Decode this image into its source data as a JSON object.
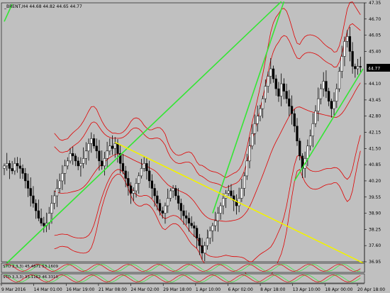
{
  "window": {
    "symbol_header": "_BRENT,H4 44.68 44.82 44.65 44.77"
  },
  "indicators": {
    "first": "STO 3,3,3) 45.4871 53.1609",
    "second": "STO 3,3,3) 33.1162 46.3310"
  },
  "chart_data": {
    "type": "candlestick",
    "symbol": "_BRENT",
    "timeframe": "H4",
    "last": {
      "open": 44.68,
      "high": 44.82,
      "low": 44.65,
      "close": 44.77
    },
    "current_price_label": "44.77",
    "ylim": [
      36.95,
      47.35
    ],
    "y_ticks": [
      "47.35",
      "46.70",
      "46.05",
      "45.40",
      "44.77",
      "44.10",
      "43.45",
      "42.80",
      "42.15",
      "41.50",
      "40.85",
      "40.20",
      "39.55",
      "38.90",
      "38.25",
      "37.60",
      "36.95"
    ],
    "x_ticks": [
      "9 Mar 2016",
      "14 Mar 01:00",
      "16 Mar 19:00",
      "21 Mar 08:00",
      "24 Mar 02:00",
      "29 Mar 18:00",
      "1 Apr 10:00",
      "6 Apr 02:00",
      "8 Apr 18:00",
      "13 Apr 10:00",
      "18 Apr 00:00",
      "20 Apr 18:00"
    ],
    "closes": [
      40.8,
      40.9,
      40.7,
      40.6,
      40.9,
      40.8,
      40.7,
      40.5,
      40.2,
      39.9,
      39.6,
      39.3,
      39.0,
      38.7,
      38.5,
      38.4,
      38.5,
      38.9,
      39.3,
      39.6,
      39.9,
      40.2,
      40.5,
      40.8,
      41.0,
      41.3,
      41.2,
      41.0,
      40.8,
      40.9,
      41.1,
      41.4,
      41.7,
      41.9,
      41.6,
      41.4,
      41.0,
      40.8,
      41.1,
      41.4,
      41.6,
      41.5,
      41.7,
      41.3,
      40.9,
      40.6,
      40.3,
      40.0,
      39.7,
      39.8,
      40.1,
      40.4,
      40.7,
      40.9,
      40.6,
      40.2,
      39.9,
      39.6,
      39.3,
      39.0,
      38.9,
      39.2,
      39.5,
      39.8,
      39.9,
      39.6,
      39.3,
      39.0,
      38.8,
      38.7,
      38.5,
      38.4,
      38.3,
      37.9,
      37.6,
      37.3,
      37.6,
      37.9,
      38.2,
      38.4,
      38.6,
      38.9,
      39.2,
      39.5,
      39.7,
      39.8,
      39.6,
      39.4,
      39.2,
      39.5,
      39.9,
      40.4,
      41.0,
      41.6,
      42.1,
      42.5,
      42.8,
      43.1,
      43.5,
      44.0,
      44.4,
      44.7,
      44.3,
      43.9,
      43.6,
      44.1,
      43.8,
      43.5,
      43.2,
      42.9,
      42.4,
      41.8,
      41.2,
      40.7,
      41.1,
      41.6,
      42.0,
      42.5,
      43.0,
      43.5,
      43.9,
      44.2,
      43.8,
      43.4,
      43.1,
      43.4,
      43.9,
      44.6,
      45.2,
      45.8,
      46.0,
      45.4,
      44.8,
      44.7,
      44.8,
      44.77
    ],
    "series": [
      {
        "name": "Bollinger 1",
        "color": "#e00000"
      },
      {
        "name": "Bollinger 2",
        "color": "#e00000"
      },
      {
        "name": "Trendline",
        "color": "#33e633"
      },
      {
        "name": "Trendline",
        "color": "#f2f200"
      }
    ]
  }
}
